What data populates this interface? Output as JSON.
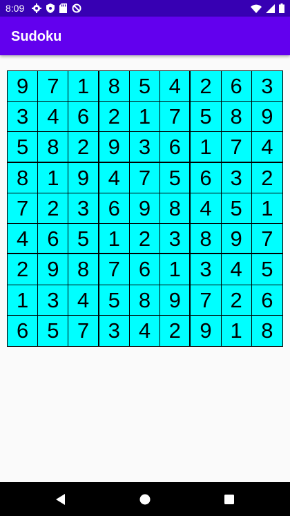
{
  "status_bar": {
    "time": "8:09",
    "left_icons": [
      "gear-icon",
      "shield-icon",
      "sd-card-icon",
      "no-disturb-icon"
    ],
    "right_icons": [
      "wifi-icon",
      "signal-icon",
      "battery-icon"
    ]
  },
  "app_bar": {
    "title": "Sudoku"
  },
  "board": {
    "cell_color": "#00ffff",
    "grid": [
      [
        "9",
        "7",
        "1",
        "8",
        "5",
        "4",
        "2",
        "6",
        "3"
      ],
      [
        "3",
        "4",
        "6",
        "2",
        "1",
        "7",
        "5",
        "8",
        "9"
      ],
      [
        "5",
        "8",
        "2",
        "9",
        "3",
        "6",
        "1",
        "7",
        "4"
      ],
      [
        "8",
        "1",
        "9",
        "4",
        "7",
        "5",
        "6",
        "3",
        "2"
      ],
      [
        "7",
        "2",
        "3",
        "6",
        "9",
        "8",
        "4",
        "5",
        "1"
      ],
      [
        "4",
        "6",
        "5",
        "1",
        "2",
        "3",
        "8",
        "9",
        "7"
      ],
      [
        "2",
        "9",
        "8",
        "7",
        "6",
        "1",
        "3",
        "4",
        "5"
      ],
      [
        "1",
        "3",
        "4",
        "5",
        "8",
        "9",
        "7",
        "2",
        "6"
      ],
      [
        "6",
        "5",
        "7",
        "3",
        "4",
        "2",
        "9",
        "1",
        "8"
      ]
    ]
  },
  "nav_bar": {
    "buttons": [
      "back-icon",
      "home-icon",
      "recents-icon"
    ]
  },
  "colors": {
    "status_bar": "#3700b3",
    "app_bar": "#6200ee",
    "background": "#fafafa"
  }
}
